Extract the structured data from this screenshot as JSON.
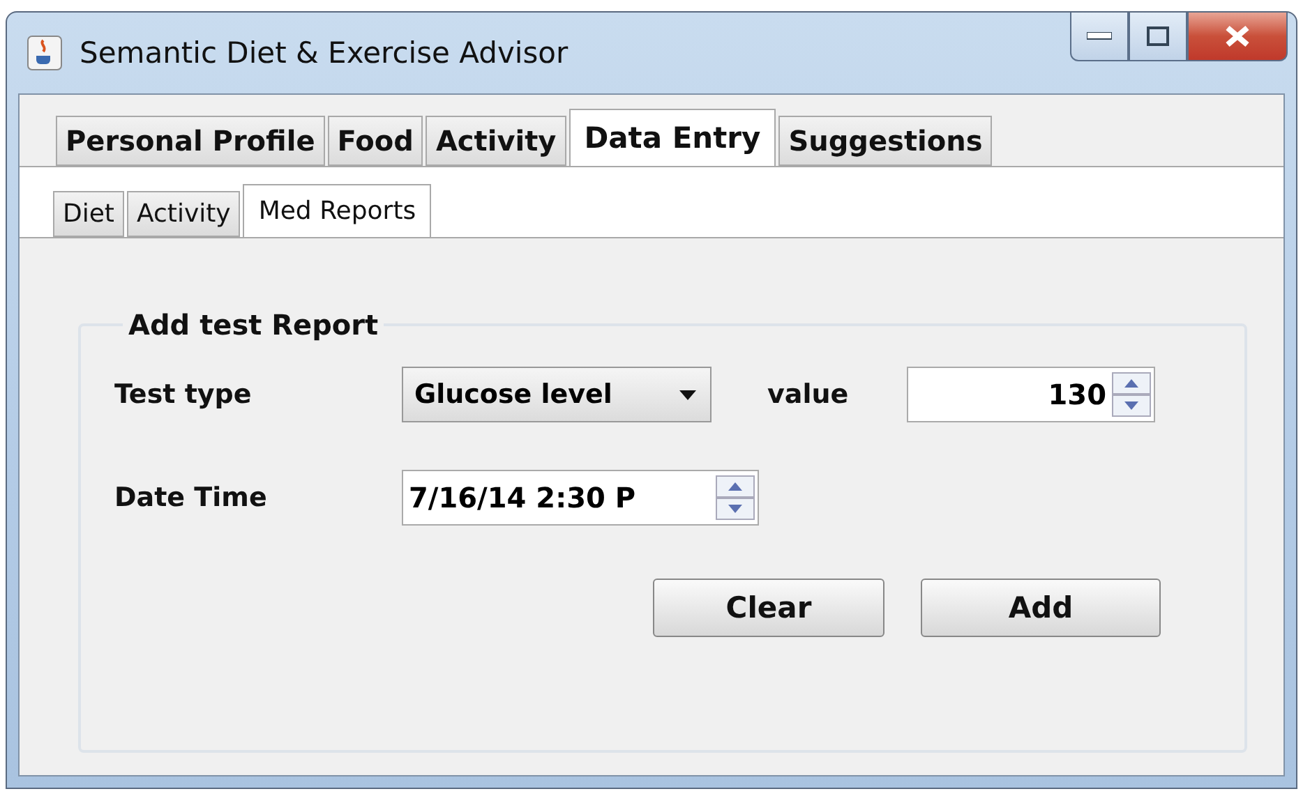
{
  "window": {
    "title": "Semantic Diet & Exercise Advisor"
  },
  "tabs": [
    {
      "label": "Personal Profile",
      "selected": false
    },
    {
      "label": "Food",
      "selected": false
    },
    {
      "label": "Activity",
      "selected": false
    },
    {
      "label": "Data Entry",
      "selected": true
    },
    {
      "label": "Suggestions",
      "selected": false
    }
  ],
  "subtabs": [
    {
      "label": "Diet",
      "selected": false
    },
    {
      "label": "Activity",
      "selected": false
    },
    {
      "label": "Med Reports",
      "selected": true
    }
  ],
  "group": {
    "title": "Add test Report",
    "test_type": {
      "label": "Test type",
      "value": "Glucose level"
    },
    "value": {
      "label": "value",
      "value": "130"
    },
    "date_time": {
      "label": "Date Time",
      "value": "7/16/14 2:30 P"
    },
    "buttons": [
      "Clear",
      "Add"
    ]
  }
}
